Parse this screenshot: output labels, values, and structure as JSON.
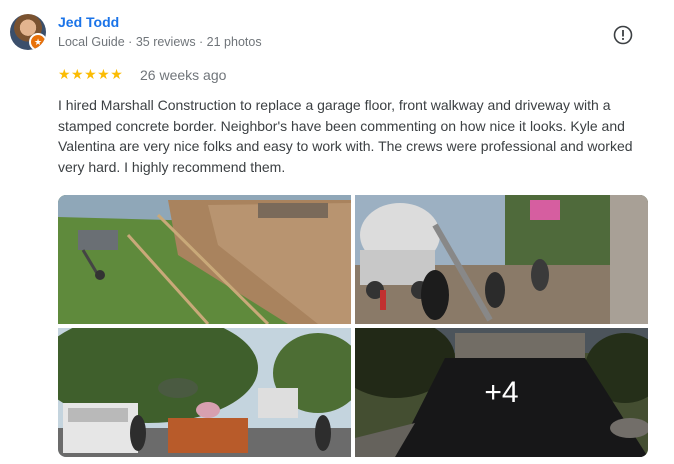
{
  "reviewer": {
    "name": "Jed Todd",
    "meta": "Local Guide · 35 reviews · 21 photos",
    "badge_icon": "local-guide-star-icon"
  },
  "rating": {
    "stars": 5,
    "stars_text": "★★★★★",
    "date": "26 weeks ago"
  },
  "review_text": "I hired Marshall Construction to replace a garage floor, front walkway and driveway with a stamped concrete border. Neighbor's have been commenting on how nice it looks. Kyle and Valentina are very nice folks and easy to work with. The crews were professional and worked very hard. I highly recommend them.",
  "photos": {
    "more_label": "+4"
  },
  "colors": {
    "name": "#1a73e8",
    "stars": "#fbbc04",
    "meta": "#70757a"
  },
  "icons": {
    "report": "report-flag-icon"
  }
}
